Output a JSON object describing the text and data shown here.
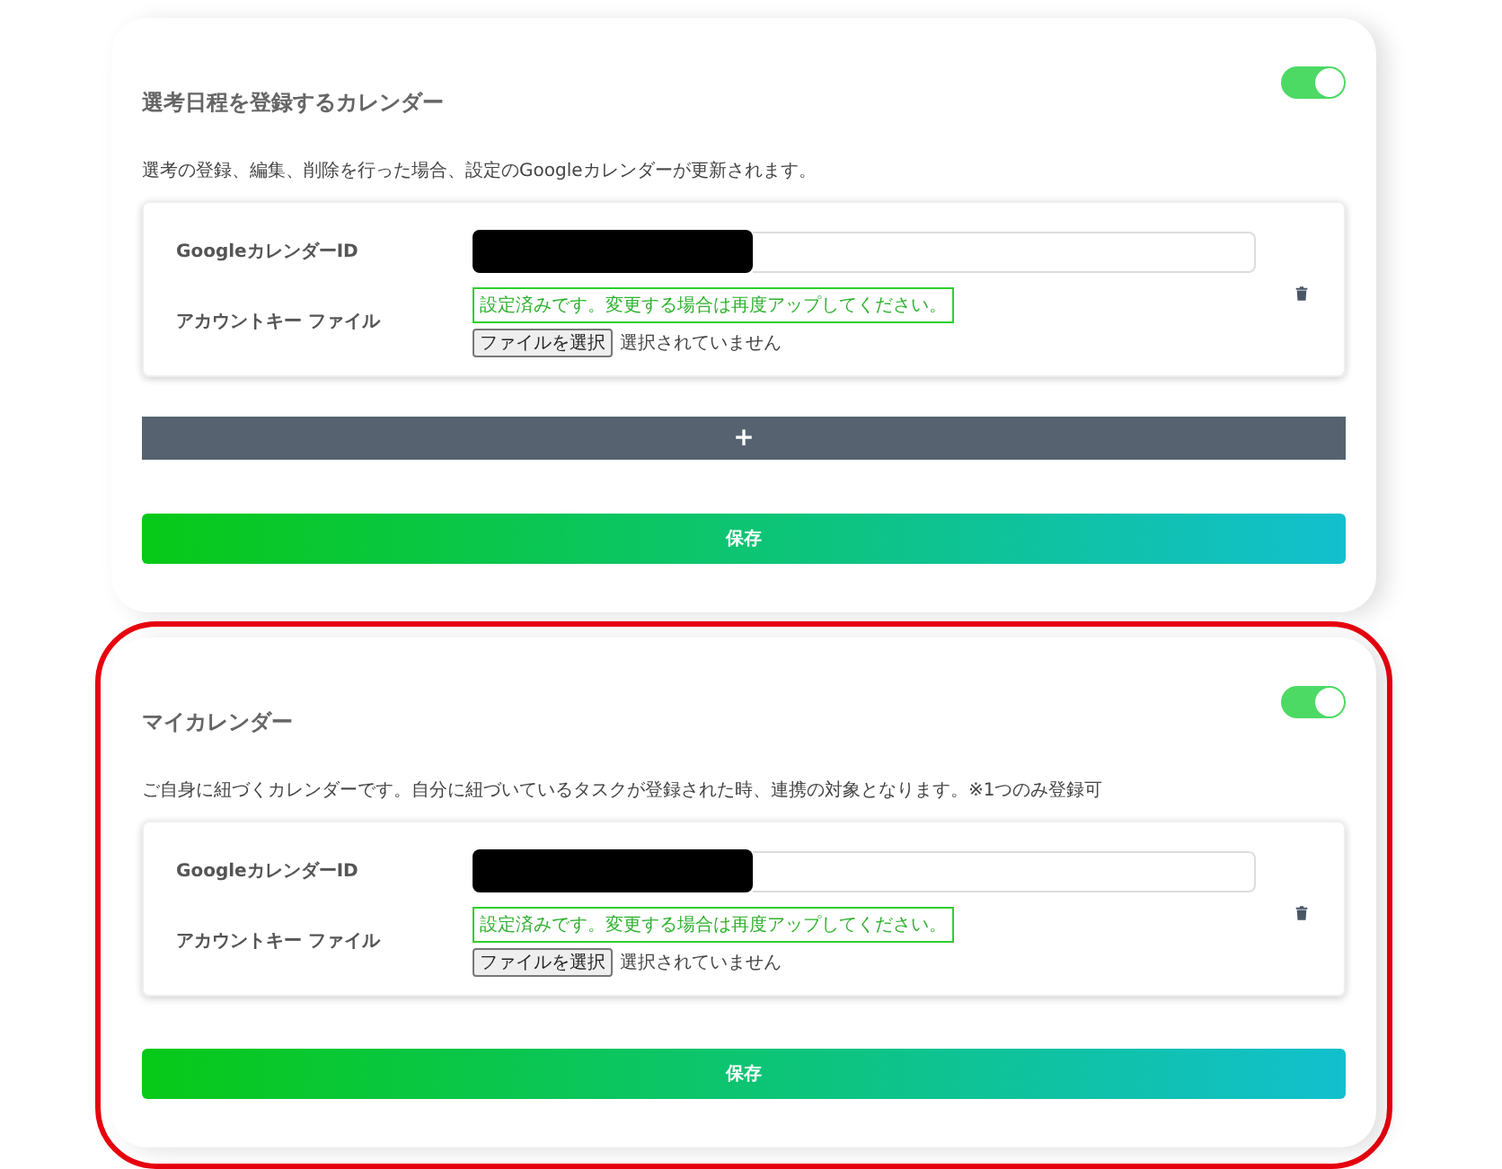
{
  "sections": [
    {
      "title": "選考日程を登録するカレンダー",
      "enabled": true,
      "highlighted": false,
      "description": "選考の登録、編集、削除を行った場合、設定のGoogleカレンダーが更新されます。",
      "entries": [
        {
          "id_label": "GoogleカレンダーID",
          "file_label": "アカウントキー ファイル",
          "status": "設定済みです。変更する場合は再度アップしてください。",
          "file_button": "ファイルを選択",
          "file_status": "選択されていません"
        }
      ],
      "add_button": "+",
      "save_button": "保存"
    },
    {
      "title": "マイカレンダー",
      "enabled": true,
      "highlighted": true,
      "description": "ご自身に紐づくカレンダーです。自分に紐づいているタスクが登録された時、連携の対象となります。※1つのみ登録可",
      "entries": [
        {
          "id_label": "GoogleカレンダーID",
          "file_label": "アカウントキー ファイル",
          "status": "設定済みです。変更する場合は再度アップしてください。",
          "file_button": "ファイルを選択",
          "file_status": "選択されていません"
        }
      ],
      "save_button": "保存"
    }
  ]
}
